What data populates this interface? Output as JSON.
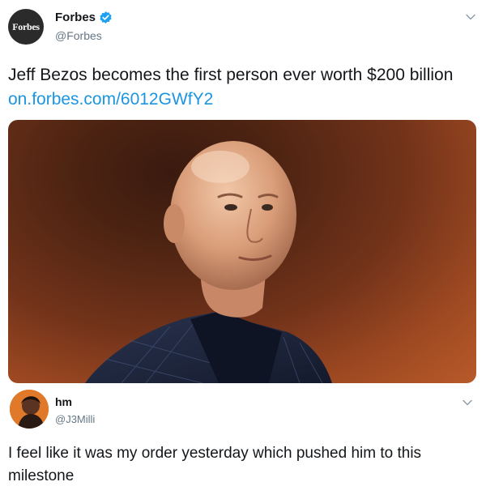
{
  "tweet": {
    "author": {
      "name": "Forbes",
      "handle": "@Forbes",
      "avatar_text": "Forbes",
      "verified": true
    },
    "text": "Jeff Bezos becomes the first person ever worth $200 billion",
    "link": "on.forbes.com/6012GWfY2",
    "menu_icon": "chevron-down-icon"
  },
  "reply": {
    "author": {
      "name": "hm",
      "handle": "@J3Milli"
    },
    "text": "I feel like it was my order yesterday which pushed him to this milestone",
    "menu_icon": "chevron-down-icon"
  },
  "colors": {
    "link": "#1b95e0",
    "verified": "#1da1f2",
    "secondary_text": "#657786"
  }
}
